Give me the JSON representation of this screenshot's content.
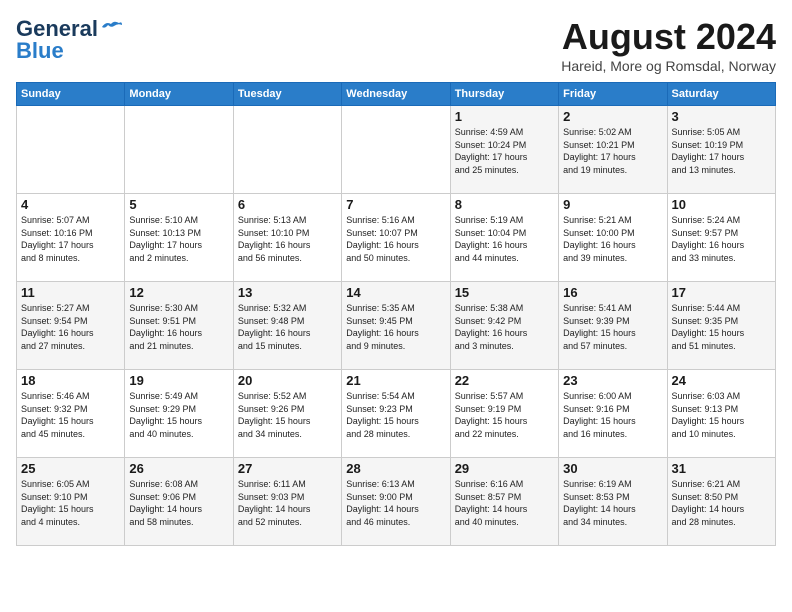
{
  "header": {
    "logo_line1": "General",
    "logo_line2": "Blue",
    "month_year": "August 2024",
    "location": "Hareid, More og Romsdal, Norway"
  },
  "weekdays": [
    "Sunday",
    "Monday",
    "Tuesday",
    "Wednesday",
    "Thursday",
    "Friday",
    "Saturday"
  ],
  "weeks": [
    [
      {
        "day": "",
        "text": ""
      },
      {
        "day": "",
        "text": ""
      },
      {
        "day": "",
        "text": ""
      },
      {
        "day": "",
        "text": ""
      },
      {
        "day": "1",
        "text": "Sunrise: 4:59 AM\nSunset: 10:24 PM\nDaylight: 17 hours\nand 25 minutes."
      },
      {
        "day": "2",
        "text": "Sunrise: 5:02 AM\nSunset: 10:21 PM\nDaylight: 17 hours\nand 19 minutes."
      },
      {
        "day": "3",
        "text": "Sunrise: 5:05 AM\nSunset: 10:19 PM\nDaylight: 17 hours\nand 13 minutes."
      }
    ],
    [
      {
        "day": "4",
        "text": "Sunrise: 5:07 AM\nSunset: 10:16 PM\nDaylight: 17 hours\nand 8 minutes."
      },
      {
        "day": "5",
        "text": "Sunrise: 5:10 AM\nSunset: 10:13 PM\nDaylight: 17 hours\nand 2 minutes."
      },
      {
        "day": "6",
        "text": "Sunrise: 5:13 AM\nSunset: 10:10 PM\nDaylight: 16 hours\nand 56 minutes."
      },
      {
        "day": "7",
        "text": "Sunrise: 5:16 AM\nSunset: 10:07 PM\nDaylight: 16 hours\nand 50 minutes."
      },
      {
        "day": "8",
        "text": "Sunrise: 5:19 AM\nSunset: 10:04 PM\nDaylight: 16 hours\nand 44 minutes."
      },
      {
        "day": "9",
        "text": "Sunrise: 5:21 AM\nSunset: 10:00 PM\nDaylight: 16 hours\nand 39 minutes."
      },
      {
        "day": "10",
        "text": "Sunrise: 5:24 AM\nSunset: 9:57 PM\nDaylight: 16 hours\nand 33 minutes."
      }
    ],
    [
      {
        "day": "11",
        "text": "Sunrise: 5:27 AM\nSunset: 9:54 PM\nDaylight: 16 hours\nand 27 minutes."
      },
      {
        "day": "12",
        "text": "Sunrise: 5:30 AM\nSunset: 9:51 PM\nDaylight: 16 hours\nand 21 minutes."
      },
      {
        "day": "13",
        "text": "Sunrise: 5:32 AM\nSunset: 9:48 PM\nDaylight: 16 hours\nand 15 minutes."
      },
      {
        "day": "14",
        "text": "Sunrise: 5:35 AM\nSunset: 9:45 PM\nDaylight: 16 hours\nand 9 minutes."
      },
      {
        "day": "15",
        "text": "Sunrise: 5:38 AM\nSunset: 9:42 PM\nDaylight: 16 hours\nand 3 minutes."
      },
      {
        "day": "16",
        "text": "Sunrise: 5:41 AM\nSunset: 9:39 PM\nDaylight: 15 hours\nand 57 minutes."
      },
      {
        "day": "17",
        "text": "Sunrise: 5:44 AM\nSunset: 9:35 PM\nDaylight: 15 hours\nand 51 minutes."
      }
    ],
    [
      {
        "day": "18",
        "text": "Sunrise: 5:46 AM\nSunset: 9:32 PM\nDaylight: 15 hours\nand 45 minutes."
      },
      {
        "day": "19",
        "text": "Sunrise: 5:49 AM\nSunset: 9:29 PM\nDaylight: 15 hours\nand 40 minutes."
      },
      {
        "day": "20",
        "text": "Sunrise: 5:52 AM\nSunset: 9:26 PM\nDaylight: 15 hours\nand 34 minutes."
      },
      {
        "day": "21",
        "text": "Sunrise: 5:54 AM\nSunset: 9:23 PM\nDaylight: 15 hours\nand 28 minutes."
      },
      {
        "day": "22",
        "text": "Sunrise: 5:57 AM\nSunset: 9:19 PM\nDaylight: 15 hours\nand 22 minutes."
      },
      {
        "day": "23",
        "text": "Sunrise: 6:00 AM\nSunset: 9:16 PM\nDaylight: 15 hours\nand 16 minutes."
      },
      {
        "day": "24",
        "text": "Sunrise: 6:03 AM\nSunset: 9:13 PM\nDaylight: 15 hours\nand 10 minutes."
      }
    ],
    [
      {
        "day": "25",
        "text": "Sunrise: 6:05 AM\nSunset: 9:10 PM\nDaylight: 15 hours\nand 4 minutes."
      },
      {
        "day": "26",
        "text": "Sunrise: 6:08 AM\nSunset: 9:06 PM\nDaylight: 14 hours\nand 58 minutes."
      },
      {
        "day": "27",
        "text": "Sunrise: 6:11 AM\nSunset: 9:03 PM\nDaylight: 14 hours\nand 52 minutes."
      },
      {
        "day": "28",
        "text": "Sunrise: 6:13 AM\nSunset: 9:00 PM\nDaylight: 14 hours\nand 46 minutes."
      },
      {
        "day": "29",
        "text": "Sunrise: 6:16 AM\nSunset: 8:57 PM\nDaylight: 14 hours\nand 40 minutes."
      },
      {
        "day": "30",
        "text": "Sunrise: 6:19 AM\nSunset: 8:53 PM\nDaylight: 14 hours\nand 34 minutes."
      },
      {
        "day": "31",
        "text": "Sunrise: 6:21 AM\nSunset: 8:50 PM\nDaylight: 14 hours\nand 28 minutes."
      }
    ]
  ]
}
